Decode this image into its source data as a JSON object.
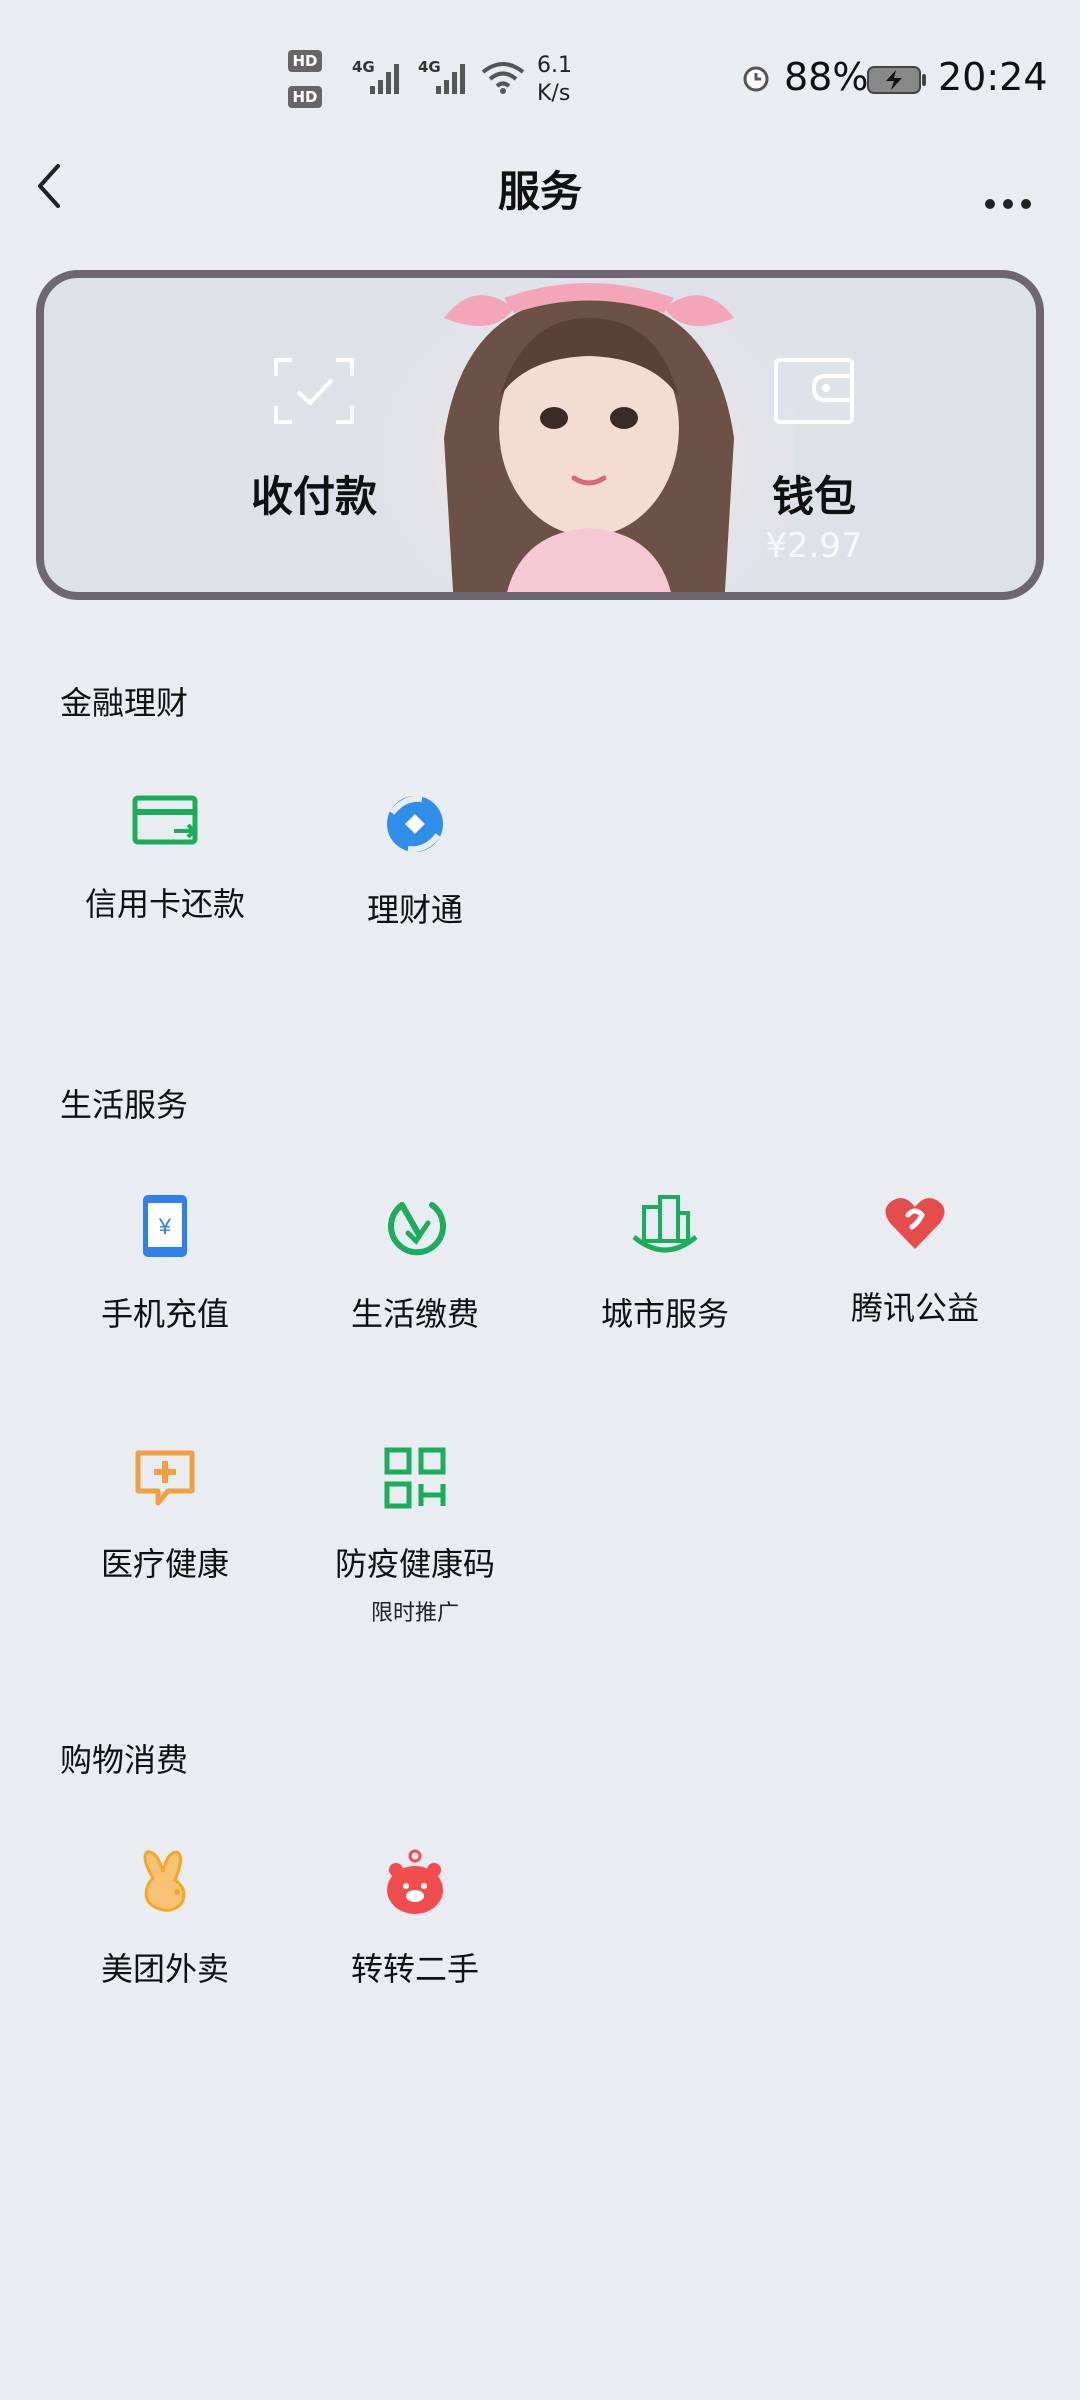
{
  "status_bar": {
    "hd1": "HD",
    "hd2": "HD",
    "net1": "4G",
    "net2": "4G",
    "speed_value": "6.1",
    "speed_unit": "K/s",
    "battery": "88%",
    "time": "20:24",
    "icons": [
      "wifi-icon",
      "alarm-icon",
      "battery-charging-icon",
      "signal-icon"
    ]
  },
  "nav": {
    "title": "服务",
    "back_icon": "chevron-left-icon",
    "more_icon": "more-horizontal-icon"
  },
  "banner": {
    "pay_label": "收付款",
    "pay_icon": "scan-check-icon",
    "wallet_label": "钱包",
    "wallet_icon": "wallet-icon",
    "wallet_amount": "¥2.97",
    "border_color": "#6e6670"
  },
  "sections": {
    "finance": {
      "title": "金融理财",
      "items": [
        {
          "label": "信用卡还款",
          "icon": "credit-card-icon",
          "color": "#1aad5c"
        },
        {
          "label": "理财通",
          "icon": "wealth-icon",
          "color": "#2f8ee8"
        }
      ]
    },
    "life": {
      "title": "生活服务",
      "items": [
        {
          "label": "手机充值",
          "icon": "phone-recharge-icon",
          "color": "#2f80e8"
        },
        {
          "label": "生活缴费",
          "icon": "utility-bill-icon",
          "color": "#1aad5c"
        },
        {
          "label": "城市服务",
          "icon": "city-icon",
          "color": "#1aad5c"
        },
        {
          "label": "腾讯公益",
          "icon": "charity-heart-icon",
          "color": "#e74c4c"
        },
        {
          "label": "医疗健康",
          "icon": "medical-icon",
          "color": "#f0a040"
        },
        {
          "label": "防疫健康码",
          "sub": "限时推广",
          "icon": "qr-code-icon",
          "color": "#1aad5c"
        }
      ]
    },
    "shopping": {
      "title": "购物消费",
      "items": [
        {
          "label": "美团外卖",
          "icon": "meituan-icon",
          "color": "#f5a623"
        },
        {
          "label": "转转二手",
          "icon": "zhuanzhuan-icon",
          "color": "#f04e4e"
        }
      ]
    }
  }
}
